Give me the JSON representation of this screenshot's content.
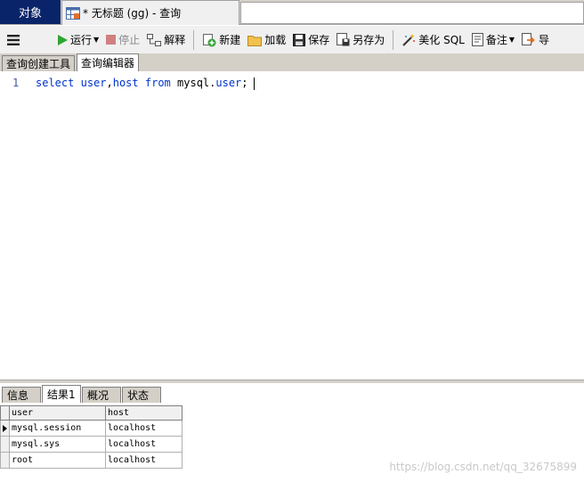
{
  "window": {
    "object_tab": "对象",
    "query_tab": "* 无标题 (gg) - 查询"
  },
  "toolbar": {
    "run": "运行",
    "stop": "停止",
    "explain": "解释",
    "new": "新建",
    "load": "加载",
    "save": "保存",
    "save_as": "另存为",
    "beautify": "美化 SQL",
    "comment": "备注",
    "export": "导"
  },
  "subtabs": {
    "builder": "查询创建工具",
    "editor": "查询编辑器"
  },
  "editor": {
    "line_number": "1",
    "tokens": {
      "select": "select",
      "col1": "user",
      "comma": ",",
      "col2": "host",
      "from": "from",
      "schema": "mysql",
      "dot": ".",
      "table": "user",
      "semicolon": ";"
    }
  },
  "result_tabs": [
    "信息",
    "结果1",
    "概况",
    "状态"
  ],
  "grid": {
    "columns": [
      "user",
      "host"
    ],
    "rows": [
      [
        "mysql.session",
        "localhost"
      ],
      [
        "mysql.sys",
        "localhost"
      ],
      [
        "root",
        "localhost"
      ]
    ]
  },
  "watermark": "https://blog.csdn.net/qq_32675899",
  "colors": {
    "object_tab_bg": "#0a246a",
    "keyword": "#0033cc",
    "run_icon": "#2fa52f",
    "stop_icon": "#d08080"
  }
}
